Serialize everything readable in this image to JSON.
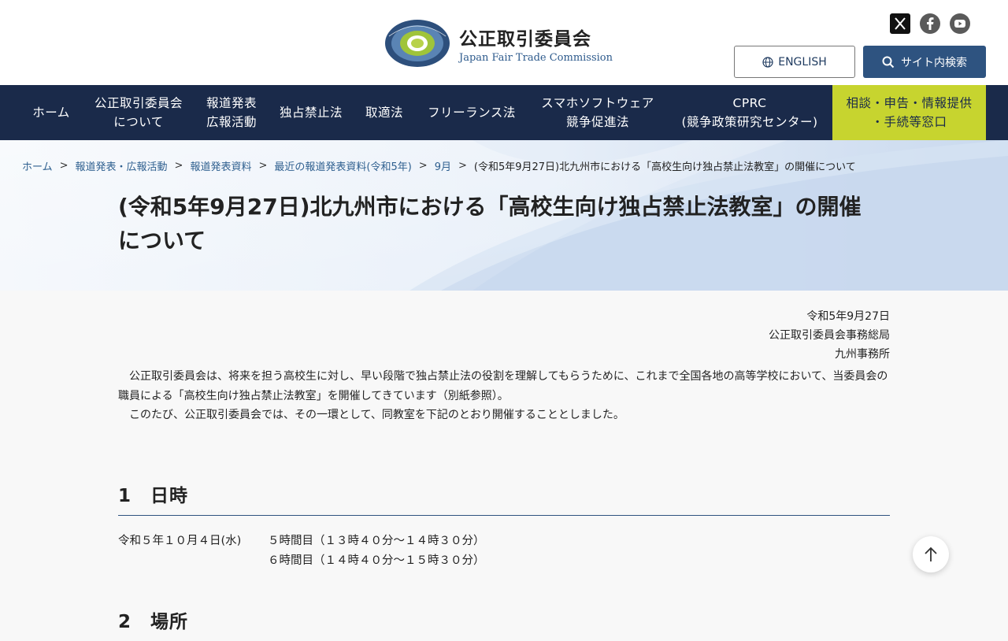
{
  "header": {
    "logo_jp": "公正取引委員会",
    "logo_en": "Japan Fair Trade Commission",
    "logo_ring_text": "JAPAN FAIR TRADE COMMISSION",
    "social": [
      {
        "name": "x-icon"
      },
      {
        "name": "facebook-icon"
      },
      {
        "name": "youtube-icon"
      }
    ],
    "english_label": "ENGLISH",
    "search_label": "サイト内検索"
  },
  "nav": {
    "items": [
      {
        "l1": "ホーム",
        "l2": ""
      },
      {
        "l1": "公正取引委員会",
        "l2": "について"
      },
      {
        "l1": "報道発表",
        "l2": "広報活動"
      },
      {
        "l1": "独占禁止法",
        "l2": ""
      },
      {
        "l1": "取適法",
        "l2": ""
      },
      {
        "l1": "フリーランス法",
        "l2": ""
      },
      {
        "l1": "スマホソフトウェア",
        "l2": "競争促進法"
      },
      {
        "l1": "CPRC",
        "l2": "(競争政策研究センター)"
      }
    ],
    "cta": {
      "l1": "相談・申告・情報提供",
      "l2": "・手続等窓口"
    }
  },
  "breadcrumb": {
    "items": [
      "ホーム",
      "報道発表・広報活動",
      "報道発表資料",
      "最近の報道発表資料(令和5年)",
      "9月"
    ],
    "current": "(令和5年9月27日)北九州市における「高校生向け独占禁止法教室」の開催について",
    "separator": ">"
  },
  "page": {
    "title": "(令和5年9月27日)北九州市における「高校生向け独占禁止法教室」の開催について",
    "date": "令和5年9月27日",
    "issuer1": "公正取引委員会事務総局",
    "issuer2": "九州事務所",
    "para1": "公正取引委員会は、将来を担う高校生に対し、早い段階で独占禁止法の役割を理解してもらうために、これまで全国各地の高等学校において、当委員会の職員による「高校生向け独占禁止法教室」を開催してきています（別紙参照）。",
    "para2": "このたび、公正取引委員会では、その一環として、同教室を下記のとおり開催することとしました。",
    "section1_title": "1　日時",
    "schedule_date": "令和５年１０月４日(水)",
    "schedule_line1": "５時間目（１３時４０分～１４時３０分）",
    "schedule_line2": "６時間目（１４時４０分～１５時３０分）",
    "section2_title": "2　場所"
  },
  "colors": {
    "nav_bg": "#1a2a4a",
    "cta_bg": "#c7d42f",
    "accent": "#2e5380",
    "link": "#2e5f8f"
  }
}
